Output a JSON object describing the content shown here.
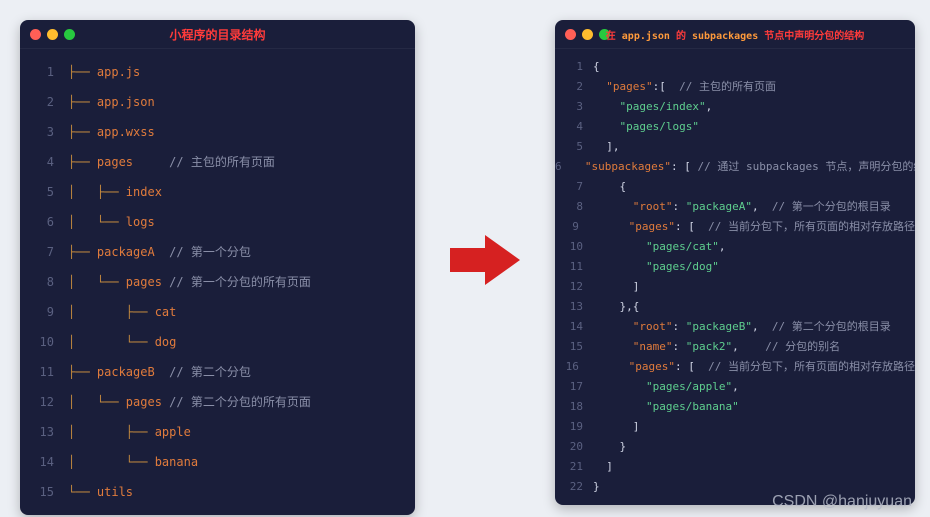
{
  "left": {
    "title": "小程序的目录结构",
    "lines": [
      {
        "n": 1,
        "segs": [
          {
            "c": "tree",
            "t": "├── "
          },
          {
            "c": "file",
            "t": "app.js"
          }
        ]
      },
      {
        "n": 2,
        "segs": [
          {
            "c": "tree",
            "t": "├── "
          },
          {
            "c": "file",
            "t": "app.json"
          }
        ]
      },
      {
        "n": 3,
        "segs": [
          {
            "c": "tree",
            "t": "├── "
          },
          {
            "c": "file",
            "t": "app.wxss"
          }
        ]
      },
      {
        "n": 4,
        "segs": [
          {
            "c": "tree",
            "t": "├── "
          },
          {
            "c": "file",
            "t": "pages"
          },
          {
            "c": "comment",
            "t": "     // 主包的所有页面"
          }
        ]
      },
      {
        "n": 5,
        "segs": [
          {
            "c": "tree",
            "t": "│   ├── "
          },
          {
            "c": "file",
            "t": "index"
          }
        ]
      },
      {
        "n": 6,
        "segs": [
          {
            "c": "tree",
            "t": "│   └── "
          },
          {
            "c": "file",
            "t": "logs"
          }
        ]
      },
      {
        "n": 7,
        "segs": [
          {
            "c": "tree",
            "t": "├── "
          },
          {
            "c": "file",
            "t": "packageA"
          },
          {
            "c": "comment",
            "t": "  // 第一个分包"
          }
        ]
      },
      {
        "n": 8,
        "segs": [
          {
            "c": "tree",
            "t": "│   └── "
          },
          {
            "c": "file",
            "t": "pages"
          },
          {
            "c": "comment",
            "t": " // 第一个分包的所有页面"
          }
        ]
      },
      {
        "n": 9,
        "segs": [
          {
            "c": "tree",
            "t": "│       ├── "
          },
          {
            "c": "file",
            "t": "cat"
          }
        ]
      },
      {
        "n": 10,
        "segs": [
          {
            "c": "tree",
            "t": "│       └── "
          },
          {
            "c": "file",
            "t": "dog"
          }
        ]
      },
      {
        "n": 11,
        "segs": [
          {
            "c": "tree",
            "t": "├── "
          },
          {
            "c": "file",
            "t": "packageB"
          },
          {
            "c": "comment",
            "t": "  // 第二个分包"
          }
        ]
      },
      {
        "n": 12,
        "segs": [
          {
            "c": "tree",
            "t": "│   └── "
          },
          {
            "c": "file",
            "t": "pages"
          },
          {
            "c": "comment",
            "t": " // 第二个分包的所有页面"
          }
        ]
      },
      {
        "n": 13,
        "segs": [
          {
            "c": "tree",
            "t": "│       ├── "
          },
          {
            "c": "file",
            "t": "apple"
          }
        ]
      },
      {
        "n": 14,
        "segs": [
          {
            "c": "tree",
            "t": "│       └── "
          },
          {
            "c": "file",
            "t": "banana"
          }
        ]
      },
      {
        "n": 15,
        "segs": [
          {
            "c": "tree",
            "t": "└── "
          },
          {
            "c": "file",
            "t": "utils"
          }
        ]
      }
    ]
  },
  "right": {
    "title_pre": "在 ",
    "title_kw1": "app.json",
    "title_mid": " 的 ",
    "title_kw2": "subpackages",
    "title_post": " 节点中声明分包的结构",
    "lines": [
      {
        "n": 1,
        "segs": [
          {
            "c": "punc",
            "t": "{"
          }
        ]
      },
      {
        "n": 2,
        "segs": [
          {
            "c": "punc",
            "t": "  "
          },
          {
            "c": "key",
            "t": "\"pages\""
          },
          {
            "c": "punc",
            "t": ":[ "
          },
          {
            "c": "comment",
            "t": " // 主包的所有页面"
          }
        ]
      },
      {
        "n": 3,
        "segs": [
          {
            "c": "punc",
            "t": "    "
          },
          {
            "c": "str",
            "t": "\"pages/index\""
          },
          {
            "c": "punc",
            "t": ","
          }
        ]
      },
      {
        "n": 4,
        "segs": [
          {
            "c": "punc",
            "t": "    "
          },
          {
            "c": "str",
            "t": "\"pages/logs\""
          }
        ]
      },
      {
        "n": 5,
        "segs": [
          {
            "c": "punc",
            "t": "  ],"
          }
        ]
      },
      {
        "n": 6,
        "segs": [
          {
            "c": "punc",
            "t": "  "
          },
          {
            "c": "key",
            "t": "\"subpackages\""
          },
          {
            "c": "punc",
            "t": ": [ "
          },
          {
            "c": "comment",
            "t": "// 通过 subpackages 节点，声明分包的结构"
          }
        ]
      },
      {
        "n": 7,
        "segs": [
          {
            "c": "punc",
            "t": "    {"
          }
        ]
      },
      {
        "n": 8,
        "segs": [
          {
            "c": "punc",
            "t": "      "
          },
          {
            "c": "key",
            "t": "\"root\""
          },
          {
            "c": "punc",
            "t": ": "
          },
          {
            "c": "str",
            "t": "\"packageA\""
          },
          {
            "c": "punc",
            "t": ", "
          },
          {
            "c": "comment",
            "t": " // 第一个分包的根目录"
          }
        ]
      },
      {
        "n": 9,
        "segs": [
          {
            "c": "punc",
            "t": "      "
          },
          {
            "c": "key",
            "t": "\"pages\""
          },
          {
            "c": "punc",
            "t": ": [ "
          },
          {
            "c": "comment",
            "t": " // 当前分包下，所有页面的相对存放路径"
          }
        ]
      },
      {
        "n": 10,
        "segs": [
          {
            "c": "punc",
            "t": "        "
          },
          {
            "c": "str",
            "t": "\"pages/cat\""
          },
          {
            "c": "punc",
            "t": ","
          }
        ]
      },
      {
        "n": 11,
        "segs": [
          {
            "c": "punc",
            "t": "        "
          },
          {
            "c": "str",
            "t": "\"pages/dog\""
          }
        ]
      },
      {
        "n": 12,
        "segs": [
          {
            "c": "punc",
            "t": "      ]"
          }
        ]
      },
      {
        "n": 13,
        "segs": [
          {
            "c": "punc",
            "t": "    },{"
          }
        ]
      },
      {
        "n": 14,
        "segs": [
          {
            "c": "punc",
            "t": "      "
          },
          {
            "c": "key",
            "t": "\"root\""
          },
          {
            "c": "punc",
            "t": ": "
          },
          {
            "c": "str",
            "t": "\"packageB\""
          },
          {
            "c": "punc",
            "t": ", "
          },
          {
            "c": "comment",
            "t": " // 第二个分包的根目录"
          }
        ]
      },
      {
        "n": 15,
        "segs": [
          {
            "c": "punc",
            "t": "      "
          },
          {
            "c": "key",
            "t": "\"name\""
          },
          {
            "c": "punc",
            "t": ": "
          },
          {
            "c": "str",
            "t": "\"pack2\""
          },
          {
            "c": "punc",
            "t": ",   "
          },
          {
            "c": "comment",
            "t": " // 分包的别名"
          }
        ]
      },
      {
        "n": 16,
        "segs": [
          {
            "c": "punc",
            "t": "      "
          },
          {
            "c": "key",
            "t": "\"pages\""
          },
          {
            "c": "punc",
            "t": ": [ "
          },
          {
            "c": "comment",
            "t": " // 当前分包下，所有页面的相对存放路径"
          }
        ]
      },
      {
        "n": 17,
        "segs": [
          {
            "c": "punc",
            "t": "        "
          },
          {
            "c": "str",
            "t": "\"pages/apple\""
          },
          {
            "c": "punc",
            "t": ","
          }
        ]
      },
      {
        "n": 18,
        "segs": [
          {
            "c": "punc",
            "t": "        "
          },
          {
            "c": "str",
            "t": "\"pages/banana\""
          }
        ]
      },
      {
        "n": 19,
        "segs": [
          {
            "c": "punc",
            "t": "      ]"
          }
        ]
      },
      {
        "n": 20,
        "segs": [
          {
            "c": "punc",
            "t": "    }"
          }
        ]
      },
      {
        "n": 21,
        "segs": [
          {
            "c": "punc",
            "t": "  ]"
          }
        ]
      },
      {
        "n": 22,
        "segs": [
          {
            "c": "punc",
            "t": "}"
          }
        ]
      }
    ]
  },
  "watermark": "CSDN @hanjuyuan"
}
